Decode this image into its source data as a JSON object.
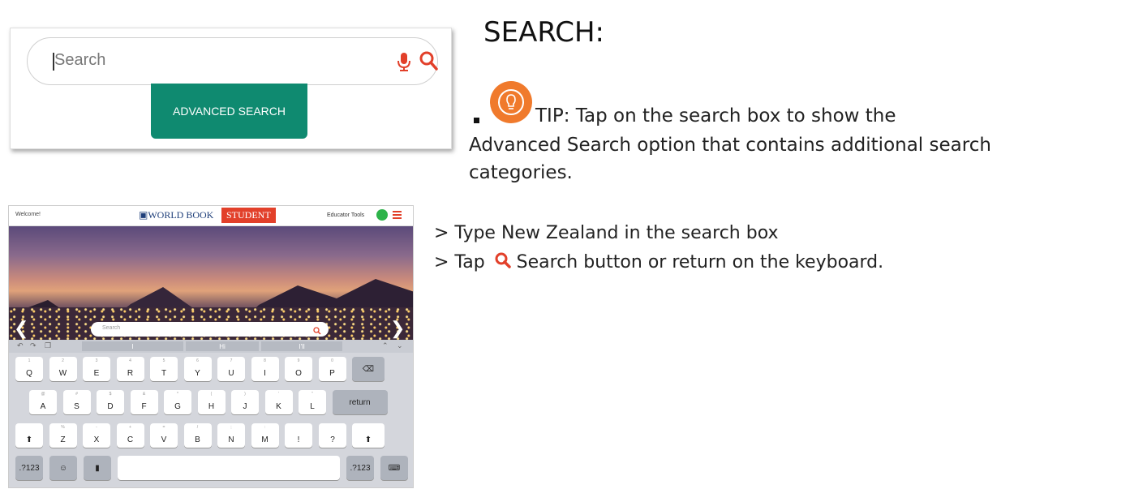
{
  "search_widget": {
    "placeholder": "Search",
    "advanced_button": "ADVANCED SEARCH",
    "icons": [
      "mic-icon",
      "search-icon"
    ],
    "colors": {
      "accent_red": "#e2402a",
      "advanced_green": "#0f8a70"
    }
  },
  "instructions": {
    "heading": "SEARCH:",
    "tip_label": "TIP:  Tap on the search box to show the",
    "tip_highlight": "Advanced Search",
    "tip_rest_1": " option that contains additional search",
    "tip_rest_2": "categories.",
    "step1_prefix": "> Type ",
    "step1_bold": "New Zealand",
    "step1_suffix": " in the search box",
    "step2_prefix": "> Tap ",
    "step2_bold": "Search",
    "step2_mid": " button or ",
    "step2_bold2": "return",
    "step2_suffix": " on the keyboard.",
    "bulb_color": "#f07a2c"
  },
  "tablet": {
    "welcome": "Welcome!",
    "logo": "WORLD BOOK",
    "student": "STUDENT",
    "educator_tools": "Educator Tools",
    "search_placeholder": "Search",
    "suggestions": [
      "I",
      "Hi",
      "I'll"
    ],
    "keyboard": {
      "row1": [
        "Q",
        "W",
        "E",
        "R",
        "T",
        "Y",
        "U",
        "I",
        "O",
        "P"
      ],
      "row1_sub": [
        "1",
        "2",
        "3",
        "4",
        "5",
        "6",
        "7",
        "8",
        "9",
        "0"
      ],
      "row2": [
        "A",
        "S",
        "D",
        "F",
        "G",
        "H",
        "J",
        "K",
        "L"
      ],
      "row2_sub": [
        "@",
        "#",
        "$",
        "&",
        "*",
        "(",
        ")",
        "'",
        "\""
      ],
      "return": "return",
      "row3": [
        "Z",
        "X",
        "C",
        "V",
        "B",
        "N",
        "M",
        "!",
        ","
      ],
      "row3_sub": [
        "%",
        "-",
        "+",
        "=",
        "/",
        ";",
        ":",
        "",
        ""
      ],
      "row3_extra": "?",
      "num_left": ".?123",
      "num_right": ".?123"
    }
  }
}
